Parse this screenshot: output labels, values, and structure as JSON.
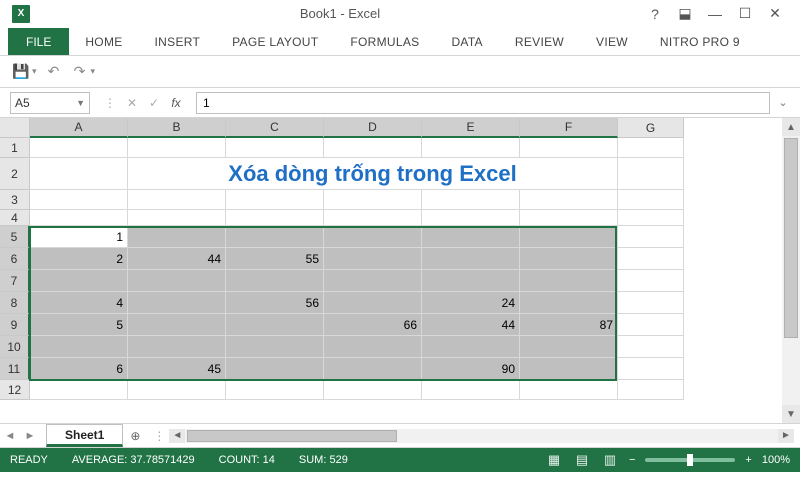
{
  "titlebar": {
    "doc": "Book1 - Excel"
  },
  "ribbonTabs": {
    "file": "FILE",
    "items": [
      "HOME",
      "INSERT",
      "PAGE LAYOUT",
      "FORMULAS",
      "DATA",
      "REVIEW",
      "VIEW",
      "NITRO PRO 9"
    ]
  },
  "formulaBar": {
    "cellRef": "A5",
    "value": "1"
  },
  "columns": [
    "A",
    "B",
    "C",
    "D",
    "E",
    "F",
    "G"
  ],
  "rows": [
    "1",
    "2",
    "3",
    "4",
    "5",
    "6",
    "7",
    "8",
    "9",
    "10",
    "11",
    "12"
  ],
  "title_text": "Xóa dòng trống trong Excel",
  "cells": {
    "r5": {
      "A": "1"
    },
    "r6": {
      "A": "2",
      "B": "44",
      "C": "55"
    },
    "r8": {
      "A": "4",
      "C": "56",
      "E": "24"
    },
    "r9": {
      "A": "5",
      "D": "66",
      "E": "44",
      "F": "87"
    },
    "r11": {
      "A": "6",
      "B": "45",
      "E": "90"
    }
  },
  "sheetTabs": {
    "active": "Sheet1"
  },
  "statusBar": {
    "mode": "READY",
    "avg_label": "AVERAGE:",
    "avg": "37.78571429",
    "count_label": "COUNT:",
    "count": "14",
    "sum_label": "SUM:",
    "sum": "529",
    "zoom": "100%"
  },
  "chart_data": null
}
